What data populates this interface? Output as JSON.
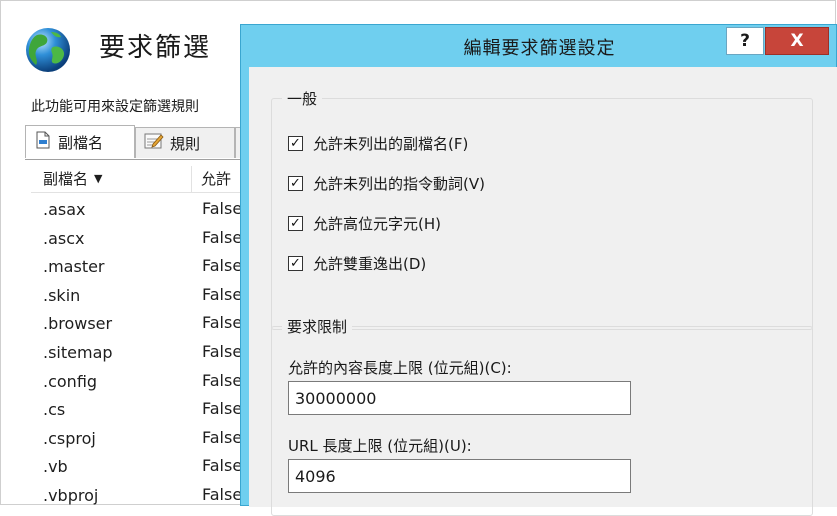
{
  "page": {
    "title": "要求篩選",
    "description": "此功能可用來設定篩選規則",
    "tabs": [
      {
        "label": "副檔名",
        "icon": "file-extension-icon"
      },
      {
        "label": "規則",
        "icon": "rules-icon"
      },
      {
        "label": "",
        "icon": "more-tabs-icon"
      }
    ],
    "table": {
      "columns": [
        "副檔名",
        "允許"
      ],
      "rows": [
        {
          "ext": ".asax",
          "val": "False"
        },
        {
          "ext": ".ascx",
          "val": "False"
        },
        {
          "ext": ".master",
          "val": "False"
        },
        {
          "ext": ".skin",
          "val": "False"
        },
        {
          "ext": ".browser",
          "val": "False"
        },
        {
          "ext": ".sitemap",
          "val": "False"
        },
        {
          "ext": ".config",
          "val": "False"
        },
        {
          "ext": ".cs",
          "val": "False"
        },
        {
          "ext": ".csproj",
          "val": "False"
        },
        {
          "ext": ".vb",
          "val": "False"
        },
        {
          "ext": ".vbproj",
          "val": "False"
        }
      ]
    }
  },
  "dialog": {
    "title": "編輯要求篩選設定",
    "help_label": "?",
    "close_label": "X",
    "general": {
      "legend": "一般",
      "options": [
        {
          "label": "允許未列出的副檔名(F)",
          "checked": true
        },
        {
          "label": "允許未列出的指令動詞(V)",
          "checked": true
        },
        {
          "label": "允許高位元字元(H)",
          "checked": true
        },
        {
          "label": "允許雙重逸出(D)",
          "checked": true
        }
      ]
    },
    "limits": {
      "legend": "要求限制",
      "content_length_label": "允許的內容長度上限 (位元組)(C):",
      "content_length_value": "30000000",
      "url_length_label": "URL 長度上限 (位元組)(U):",
      "url_length_value": "4096"
    }
  },
  "colors": {
    "dialog_frame": "#6fcfef",
    "close_button": "#c7453a",
    "dialog_client": "#f0f0f0"
  }
}
